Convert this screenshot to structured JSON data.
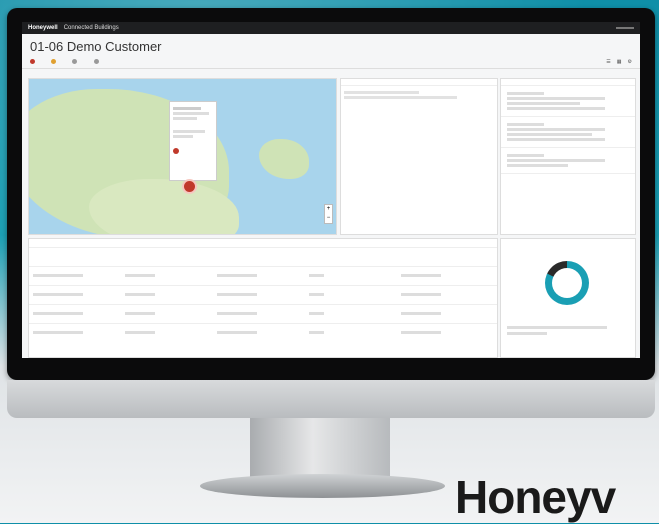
{
  "app": {
    "logo": "Honeywell",
    "name": "Connected Buildings",
    "account": "",
    "breadcrumb": ""
  },
  "page_title": "01-06 Demo Customer",
  "tabs": [
    {
      "label": "",
      "color": "#c0392b"
    },
    {
      "label": "",
      "color": "#e0a030"
    },
    {
      "label": "",
      "color": "#999999"
    },
    {
      "label": "",
      "color": "#999999"
    }
  ],
  "map": {
    "labels": [
      "",
      "",
      ""
    ]
  },
  "side_panel": {
    "title": "",
    "action": ""
  },
  "feed": {
    "title": ""
  },
  "table": {
    "title": "",
    "columns": [
      "",
      "",
      "",
      "",
      ""
    ]
  },
  "chart": {
    "title": "",
    "center_value": ""
  },
  "brand_text": "Honeyv"
}
